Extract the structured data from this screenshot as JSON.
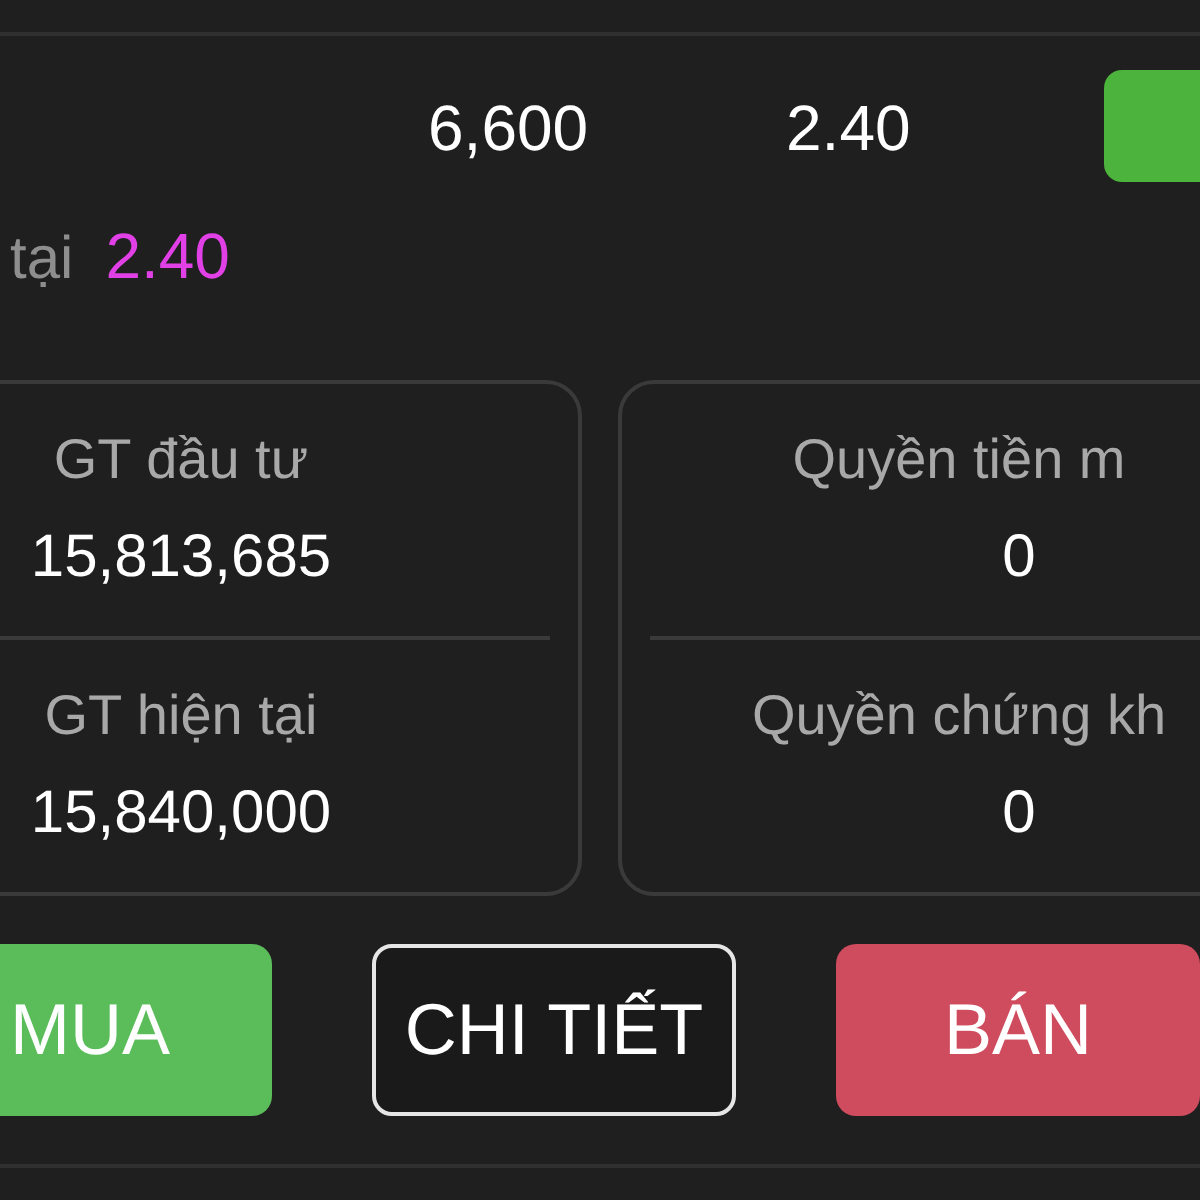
{
  "summary_row": {
    "volume": "6,600",
    "price": "2.40"
  },
  "current_price": {
    "label": "tại",
    "value": "2.40"
  },
  "cards": [
    {
      "items": [
        {
          "label": "GT đầu tư",
          "value": "15,813,685"
        },
        {
          "label": "GT hiện tại",
          "value": "15,840,000"
        }
      ]
    },
    {
      "items": [
        {
          "label": "Quyền tiền m",
          "value": "0"
        },
        {
          "label": "Quyền chứng kh",
          "value": "0"
        }
      ]
    }
  ],
  "buttons": [
    {
      "label": "MUA",
      "kind": "buy"
    },
    {
      "label": "CHI TIẾT",
      "kind": "detail"
    },
    {
      "label": "BÁN",
      "kind": "sell"
    }
  ]
}
